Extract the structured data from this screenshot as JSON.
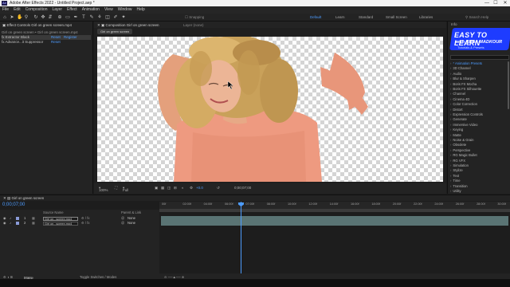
{
  "titlebar": {
    "app_logo": "Ae",
    "title": "Adobe After Effects 2022 - Untitled Project.aep *",
    "minimize": "—",
    "maximize": "☐",
    "close": "✕"
  },
  "menu": [
    "File",
    "Edit",
    "Composition",
    "Layer",
    "Effect",
    "Animation",
    "View",
    "Window",
    "Help"
  ],
  "toolbar": {
    "snapping": "Snapping",
    "workspaces": [
      "Default",
      "Learn",
      "Standard",
      "Small Screen",
      "Libraries"
    ],
    "active_workspace": "Default",
    "search_placeholder": "Search Help"
  },
  "effect_controls": {
    "tab_label": "Effect Controls Girl on green screen.mp4",
    "header": "Girl on green screen • Girl on green screen.mp4",
    "rows": [
      {
        "name": "fx  Extractor Black",
        "action1": "Reset",
        "action2": "Register"
      },
      {
        "name": "fx  Advance...it Suppressor",
        "action1": "Reset",
        "action2": ""
      }
    ]
  },
  "composition": {
    "tab_label": "Composition Girl on green screen",
    "layer_tab": "Layer (none)",
    "breadcrumb": "Girl on green screen",
    "zoom": "100%",
    "resolution": "Full",
    "exposure": "+0.0",
    "timecode": "0;00;07;00"
  },
  "right_panel": {
    "info_tab": "Info",
    "logo": {
      "line1": "EASY TO LEARN",
      "line2": "with REBA MADKOUR",
      "line3": "Tutorials & Presets"
    },
    "effects": [
      "* Animation Presets",
      "3D Channel",
      "Audio",
      "Blur & Sharpen",
      "Boris FX Mocha",
      "Boris FX Silhouette",
      "Channel",
      "Cinema 4D",
      "Color Correction",
      "Distort",
      "Expression Controls",
      "Generate",
      "Immersive Video",
      "Keying",
      "Matte",
      "Noise & Grain",
      "Obsolete",
      "Perspective",
      "RG Magic Bullet",
      "RG VFX",
      "Simulation",
      "Stylize",
      "Text",
      "Time",
      "Transition",
      "Utility"
    ]
  },
  "timeline": {
    "tab_label": "Girl on green screen",
    "timecode": "0;00;07;00",
    "col_source": "Source Name",
    "col_parent": "Parent & Link",
    "layers": [
      {
        "num": "1",
        "name": "Girl on...screen.mp4",
        "parent": "None",
        "color": "#8a9bd8"
      },
      {
        "num": "2",
        "name": "Girl on...screen.mp4",
        "parent": "None",
        "color": "#8a9bd8"
      }
    ],
    "ruler_ticks": [
      "00f",
      "02:00f",
      "04:00f",
      "06:00f",
      "07:00f",
      "08:00f",
      "10:00f",
      "12:00f",
      "14:00f",
      "16:00f",
      "18:00f",
      "20:00f",
      "22:00f",
      "24:00f",
      "26:00f",
      "28:00f",
      "30:00f"
    ],
    "footer_render": "Frame Render Time:",
    "footer_render_value": "34ms",
    "footer_toggle": "Toggle Switches / Modes"
  },
  "colors": {
    "accent": "#4d9cff",
    "panel": "#232323",
    "bg": "#1d1d1d",
    "track": "#5a7474",
    "logo_blue": "#1e3cff"
  }
}
